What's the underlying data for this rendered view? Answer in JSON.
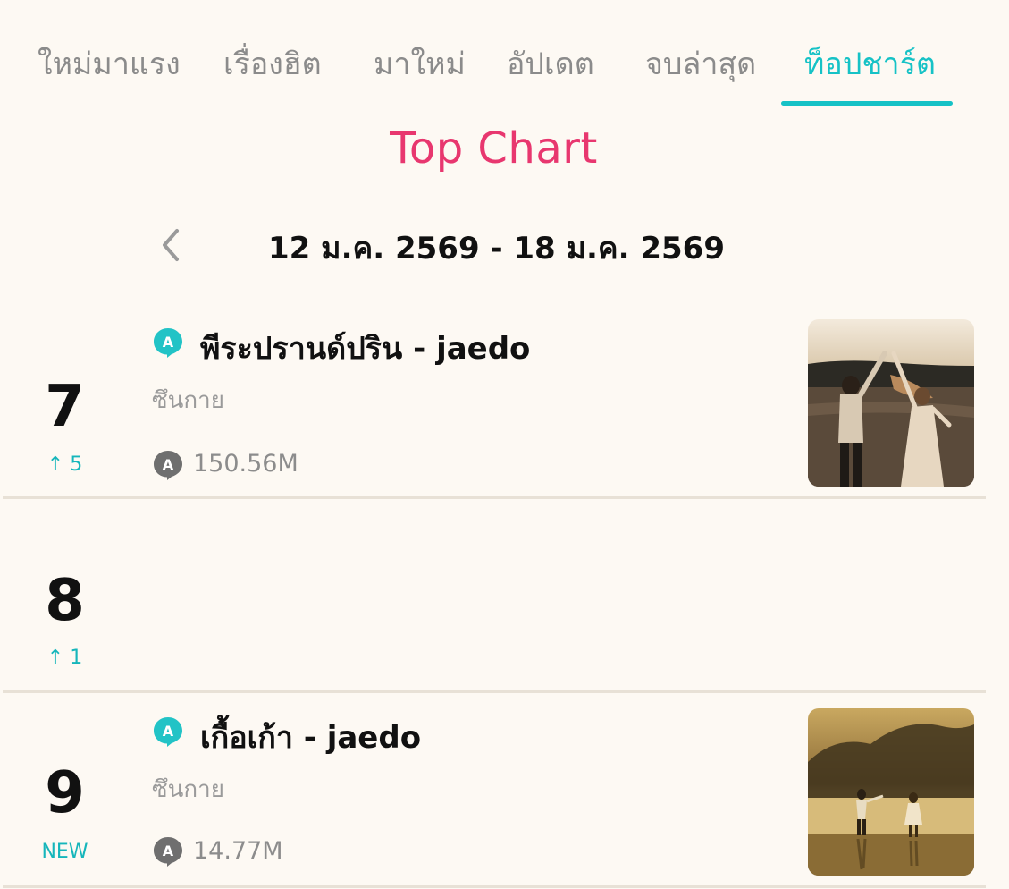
{
  "tabs": [
    {
      "label": "ใหม่มาแรง",
      "active": false
    },
    {
      "label": "เรื่องฮิต",
      "active": false
    },
    {
      "label": "มาใหม่",
      "active": false
    },
    {
      "label": "อัปเดต",
      "active": false
    },
    {
      "label": "จบล่าสุด",
      "active": false
    },
    {
      "label": "ท็อปชาร์ต",
      "active": true
    }
  ],
  "chart_title": "Top Chart",
  "date_range": "12 ม.ค. 2569 - 18 ม.ค. 2569",
  "colors": {
    "accent": "#16c2c6",
    "title": "#e8376f",
    "background": "#fdf9f3"
  },
  "entries": [
    {
      "rank": "7",
      "change": "↑ 5",
      "title": "พีระปรานด์ปริน - jaedo",
      "author": "ซึนกาย",
      "views": "150.56M"
    },
    {
      "rank": "8",
      "change": "↑ 1"
    },
    {
      "rank": "9",
      "change": "NEW",
      "title": "เกื้อเก้า - jaedo",
      "author": "ซึนกาย",
      "views": "14.77M"
    }
  ]
}
